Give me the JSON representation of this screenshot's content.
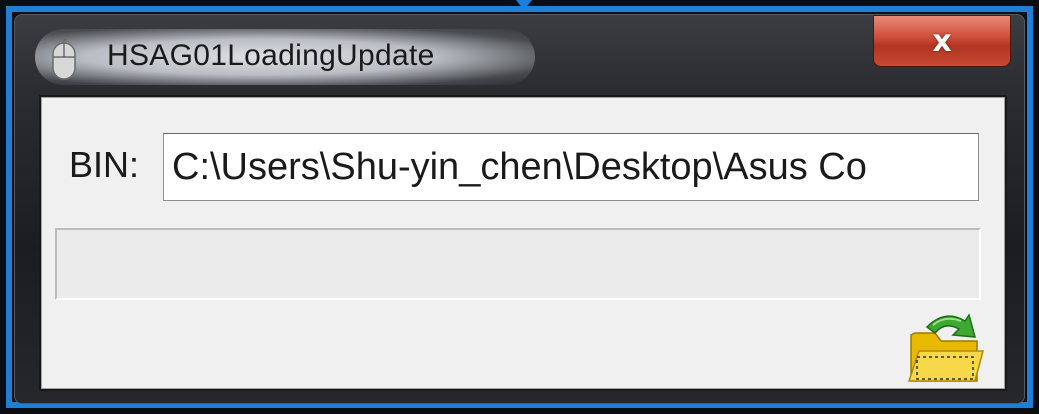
{
  "window": {
    "title": "HSAG01LoadingUpdate",
    "close_glyph": "x"
  },
  "form": {
    "bin_label": "BIN:",
    "bin_path": "C:\\Users\\Shu-yin_chen\\Desktop\\Asus Co"
  },
  "progress": {
    "value": 0
  },
  "icons": {
    "app": "mouse-icon",
    "open": "open-folder-icon"
  },
  "colors": {
    "highlight": "#1f7fd6",
    "close_button": "#c94a32",
    "client_bg": "#f0f0f0"
  }
}
